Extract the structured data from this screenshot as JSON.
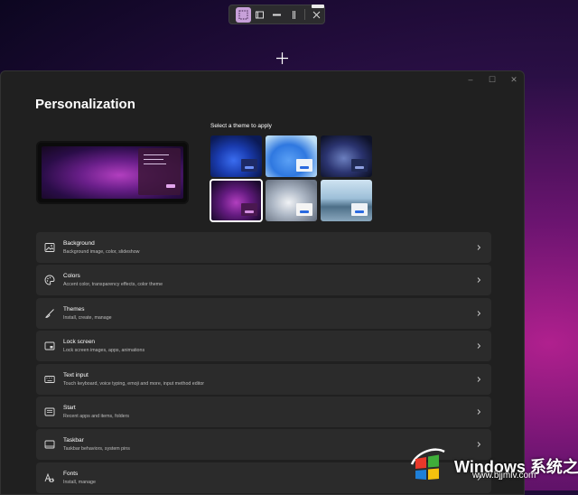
{
  "snip_toolbar": {
    "tools": [
      {
        "icon": "rectangle-snip-icon",
        "active": true
      },
      {
        "icon": "window-snip-icon",
        "active": false
      },
      {
        "icon": "fullscreen-snip-icon",
        "active": false
      },
      {
        "icon": "freeform-snip-icon",
        "active": false
      }
    ],
    "close_icon": "close-icon"
  },
  "window": {
    "controls": {
      "minimize": "–",
      "maximize": "☐",
      "close": "✕"
    }
  },
  "page": {
    "title": "Personalization",
    "themes_label": "Select a theme to apply"
  },
  "themes": [
    {
      "name": "bloom-blue",
      "selected": false
    },
    {
      "name": "bloom-light",
      "selected": false
    },
    {
      "name": "captured-motion",
      "selected": false
    },
    {
      "name": "glow",
      "selected": true
    },
    {
      "name": "flow",
      "selected": false
    },
    {
      "name": "sunrise",
      "selected": false
    }
  ],
  "settings": [
    {
      "title": "Background",
      "subtitle": "Background image, color, slideshow",
      "icon": "image-icon"
    },
    {
      "title": "Colors",
      "subtitle": "Accent color, transparency effects, color theme",
      "icon": "palette-icon"
    },
    {
      "title": "Themes",
      "subtitle": "Install, create, manage",
      "icon": "brush-icon"
    },
    {
      "title": "Lock screen",
      "subtitle": "Lock screen images, apps, animations",
      "icon": "lock-screen-icon"
    },
    {
      "title": "Text input",
      "subtitle": "Touch keyboard, voice typing, emoji and more, input method editor",
      "icon": "keyboard-icon"
    },
    {
      "title": "Start",
      "subtitle": "Recent apps and items, folders",
      "icon": "start-icon"
    },
    {
      "title": "Taskbar",
      "subtitle": "Taskbar behaviors, system pins",
      "icon": "taskbar-icon"
    },
    {
      "title": "Fonts",
      "subtitle": "Install, manage",
      "icon": "fonts-icon"
    }
  ],
  "watermark": {
    "title": "Windows 系统之家",
    "url": "www.bjjmlv.com"
  },
  "colors": {
    "window_bg": "#202020",
    "row_bg": "#2b2b2b",
    "accent": "#c7a0d9"
  }
}
